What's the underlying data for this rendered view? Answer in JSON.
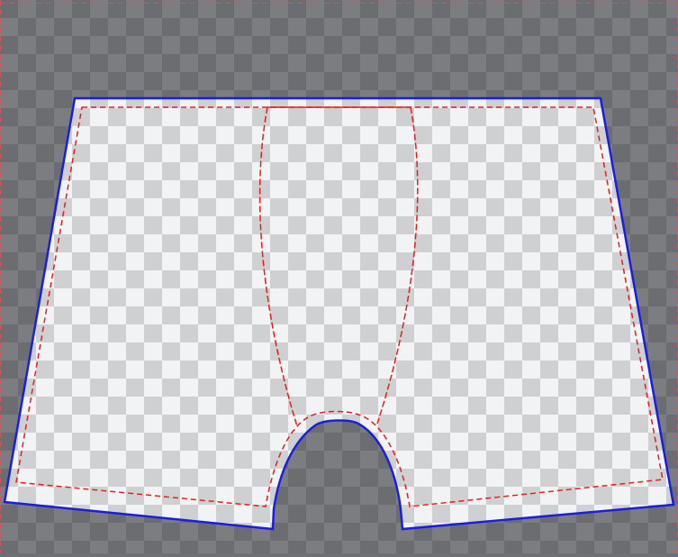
{
  "canvas": {
    "outer_checker_colors": [
      "#6b6d71",
      "#7b7d81"
    ],
    "inner_checker_colors": [
      "#cfd0d2",
      "#f2f3f5"
    ],
    "frame_line_color": "#d2555a"
  },
  "pattern": {
    "cut_line_color": "#1a1ee0",
    "seam_line_color": "#ea1c1c",
    "seam_line_style": "dashed"
  }
}
